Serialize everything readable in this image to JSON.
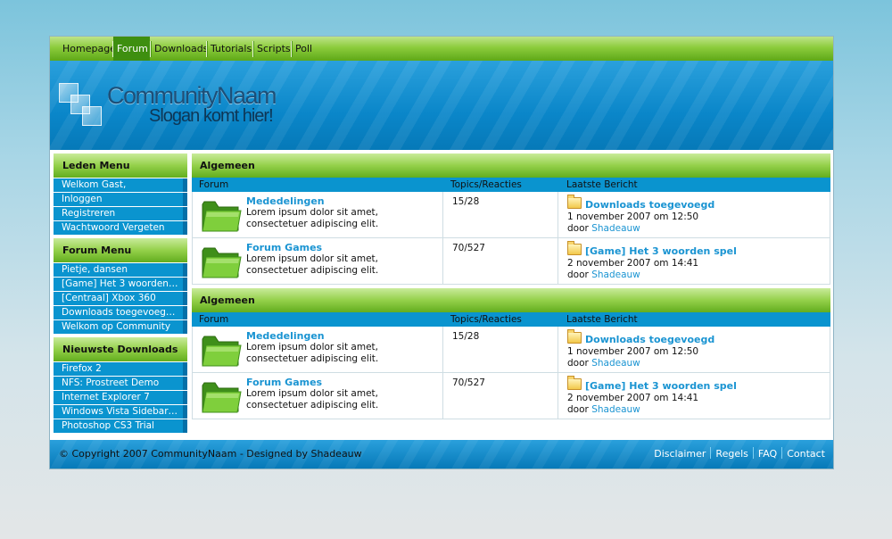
{
  "nav": {
    "items": [
      "Homepage",
      "Forum",
      "Downloads",
      "Tutorials",
      "Scripts",
      "Poll"
    ],
    "active": "Forum"
  },
  "header": {
    "logo_name": "CommunityNaam",
    "slogan": "Slogan komt hier!"
  },
  "sidebar": {
    "leden": {
      "title": "Leden Menu",
      "items": [
        "Welkom Gast,",
        "Inloggen",
        "Registreren",
        "Wachtwoord Vergeten"
      ]
    },
    "forum": {
      "title": "Forum Menu",
      "items": [
        "Pietje, dansen",
        "[Game] Het 3 woorden…",
        "[Centraal] Xbox 360",
        "Downloads toegevoeg…",
        "Welkom op Community"
      ]
    },
    "downloads": {
      "title": "Nieuwste Downloads",
      "items": [
        "Firefox 2",
        "NFS: Prostreet Demo",
        "Internet Explorer 7",
        "Windows Vista Sidebar…",
        "Photoshop CS3 Trial"
      ]
    }
  },
  "forum": {
    "columns": {
      "forum": "Forum",
      "topics": "Topics/Reacties",
      "last": "Laatste Bericht"
    },
    "sections": [
      {
        "title": "Algemeen",
        "rows": [
          {
            "name": "Mededelingen",
            "desc": "Lorem ipsum dolor sit amet, consectetuer adipiscing elit.",
            "count": "15/28",
            "last_title": "Downloads toegevoegd",
            "last_date": "1 november 2007 om 12:50",
            "by": "door",
            "author": "Shadeauw"
          },
          {
            "name": "Forum Games",
            "desc": "Lorem ipsum dolor sit amet, consectetuer adipiscing elit.",
            "count": "70/527",
            "last_title": "[Game] Het 3 woorden spel",
            "last_date": "2 november 2007 om 14:41",
            "by": "door",
            "author": "Shadeauw"
          }
        ]
      },
      {
        "title": "Algemeen",
        "rows": [
          {
            "name": "Mededelingen",
            "desc": "Lorem ipsum dolor sit amet, consectetuer adipiscing elit.",
            "count": "15/28",
            "last_title": "Downloads toegevoegd",
            "last_date": "1 november 2007 om 12:50",
            "by": "door",
            "author": "Shadeauw"
          },
          {
            "name": "Forum Games",
            "desc": "Lorem ipsum dolor sit amet, consectetuer adipiscing elit.",
            "count": "70/527",
            "last_title": "[Game] Het 3 woorden spel",
            "last_date": "2 november 2007 om 14:41",
            "by": "door",
            "author": "Shadeauw"
          }
        ]
      }
    ]
  },
  "footer": {
    "copyright": "© Copyright 2007 CommunityNaam - Designed by Shadeauw",
    "links": [
      "Disclaimer",
      "Regels",
      "FAQ",
      "Contact"
    ]
  }
}
